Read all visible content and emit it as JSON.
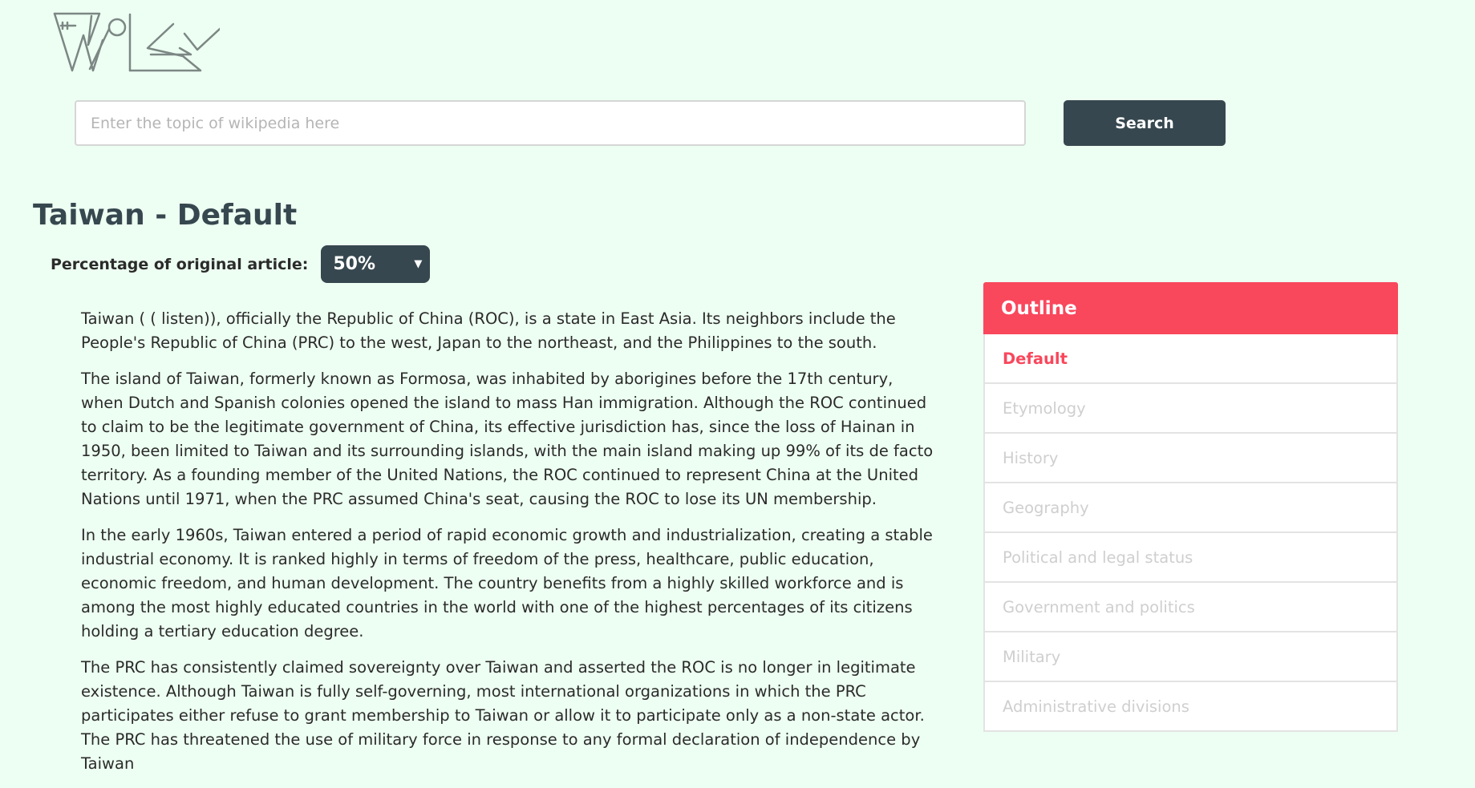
{
  "search": {
    "placeholder": "Enter the topic of wikipedia here",
    "button_label": "Search"
  },
  "page": {
    "title": "Taiwan - Default",
    "percentage_label": "Percentage of original article:",
    "percentage_value": "50%"
  },
  "article": {
    "paragraphs": [
      "Taiwan ( ( listen)), officially the Republic of China (ROC), is a state in East Asia. Its neighbors include the People's Republic of China (PRC) to the west, Japan to the northeast, and the Philippines to the south.",
      "The island of Taiwan, formerly known as Formosa, was inhabited by aborigines before the 17th century, when Dutch and Spanish colonies opened the island to mass Han immigration. Although the ROC continued to claim to be the legitimate government of China, its effective jurisdiction has, since the loss of Hainan in 1950, been limited to Taiwan and its surrounding islands, with the main island making up 99% of its de facto territory. As a founding member of the United Nations, the ROC continued to represent China at the United Nations until 1971, when the PRC assumed China's seat, causing the ROC to lose its UN membership.",
      "In the early 1960s, Taiwan entered a period of rapid economic growth and industrialization, creating a stable industrial economy. It is ranked highly in terms of freedom of the press, healthcare, public education, economic freedom, and human development. The country benefits from a highly skilled workforce and is among the most highly educated countries in the world with one of the highest percentages of its citizens holding a tertiary education degree.",
      "The PRC has consistently claimed sovereignty over Taiwan and asserted the ROC is no longer in legitimate existence. Although Taiwan is fully self-governing, most international organizations in which the PRC participates either refuse to grant membership to Taiwan or allow it to participate only as a non-state actor. The PRC has threatened the use of military force in response to any formal declaration of independence by Taiwan"
    ]
  },
  "outline": {
    "title": "Outline",
    "items": [
      "Default",
      "Etymology",
      "History",
      "Geography",
      "Political and legal status",
      "Government and politics",
      "Military",
      "Administrative divisions"
    ]
  },
  "colors": {
    "background": "#edfff2",
    "dark": "#37474f",
    "accent": "#f9475c"
  }
}
